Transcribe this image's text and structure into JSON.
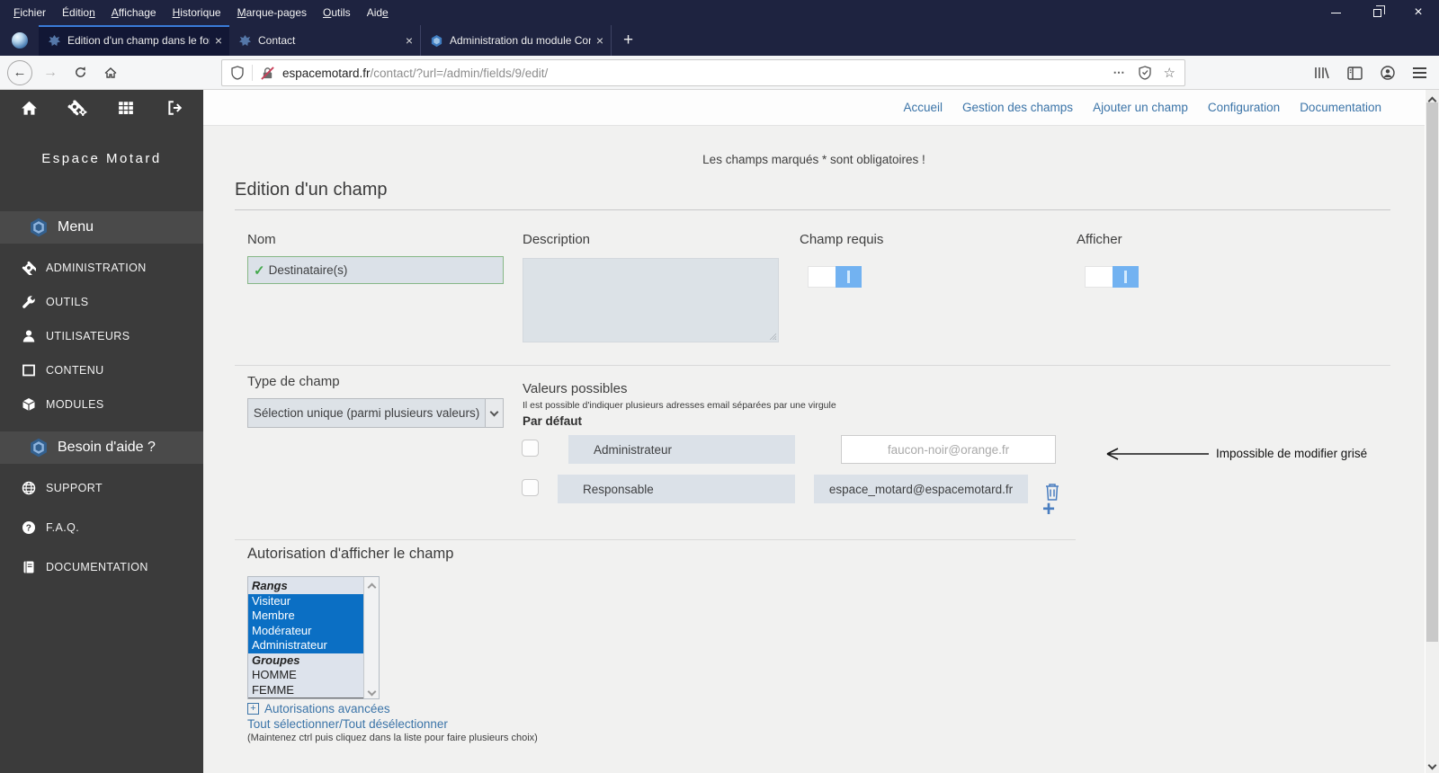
{
  "colors": {
    "titlebar_bg": "#1e2340",
    "active_tab_line": "#3a7bd8",
    "sidebar_bg": "#3b3b3b",
    "sidebar_band_bg": "#4a4a4a",
    "link_blue": "#3b74a8",
    "selection_blue": "#0b6fc4",
    "toggle_blue": "#72b2f1",
    "check_green": "#44a94d",
    "action_blue": "#4a7ec0"
  },
  "icons": {
    "close": "×",
    "new_tab": "+",
    "more": "⋯",
    "star": "☆",
    "back": "←",
    "forward": "→",
    "check": "✓",
    "plus": "+",
    "slash": "/"
  },
  "browser": {
    "menubar": [
      {
        "pre": "",
        "key": "F",
        "post": "ichier"
      },
      {
        "pre": "Éditio",
        "key": "n",
        "post": ""
      },
      {
        "pre": "",
        "key": "A",
        "post": "ffichage"
      },
      {
        "pre": "",
        "key": "H",
        "post": "istorique"
      },
      {
        "pre": "",
        "key": "M",
        "post": "arque-pages"
      },
      {
        "pre": "",
        "key": "O",
        "post": "utils"
      },
      {
        "pre": "Aid",
        "key": "e",
        "post": ""
      }
    ],
    "tabs": [
      {
        "title": "Edition d'un champ dans le for"
      },
      {
        "title": "Contact"
      },
      {
        "title": "Administration du module Con"
      }
    ],
    "url": {
      "domain": "espacemotard.fr",
      "path": "/contact/?url=/admin/fields/9/edit/"
    }
  },
  "sidebar": {
    "brand": "Espace Motard",
    "menu_header": "Menu",
    "items": [
      {
        "label": "ADMINISTRATION"
      },
      {
        "label": "OUTILS"
      },
      {
        "label": "UTILISATEURS"
      },
      {
        "label": "CONTENU"
      },
      {
        "label": "MODULES"
      }
    ],
    "help_header": "Besoin d'aide ?",
    "help_items": [
      {
        "label": "SUPPORT"
      },
      {
        "label": "F.A.Q."
      },
      {
        "label": "DOCUMENTATION"
      }
    ]
  },
  "topnav": {
    "links": [
      "Accueil",
      "Gestion des champs",
      "Ajouter un champ",
      "Configuration",
      "Documentation"
    ]
  },
  "page": {
    "required_note": "Les champs marqués * sont obligatoires !",
    "title": "Edition d'un champ",
    "nom": {
      "label": "Nom",
      "value": "Destinataire(s)"
    },
    "description": {
      "label": "Description"
    },
    "champ_requis": {
      "label": "Champ requis",
      "state": "on"
    },
    "afficher": {
      "label": "Afficher",
      "state": "on"
    },
    "type": {
      "label": "Type de champ",
      "value": "Sélection unique (parmi plusieurs valeurs)"
    },
    "valeurs": {
      "label": "Valeurs possibles",
      "hint": "Il est possible d'indiquer plusieurs adresses email séparées par une virgule",
      "default_label": "Par défaut",
      "rows": [
        {
          "name": "Administrateur",
          "email": "faucon-noir@orange.fr",
          "email_disabled": true
        },
        {
          "name": "Responsable",
          "email": "espace_motard@espacemotard.fr",
          "email_disabled": false
        }
      ]
    },
    "autorisation": {
      "label": "Autorisation d'afficher le champ",
      "items": [
        {
          "label": "Rangs",
          "type": "header",
          "selected": false
        },
        {
          "label": "Visiteur",
          "type": "option",
          "selected": true
        },
        {
          "label": "Membre",
          "type": "option",
          "selected": true
        },
        {
          "label": "Modérateur",
          "type": "option",
          "selected": true
        },
        {
          "label": "Administrateur",
          "type": "option",
          "selected": true
        },
        {
          "label": "Groupes",
          "type": "header",
          "selected": false
        },
        {
          "label": "HOMME",
          "type": "option",
          "selected": false
        },
        {
          "label": "FEMME",
          "type": "option",
          "selected": false
        }
      ],
      "advanced_link": "Autorisations avancées",
      "select_all": "Tout sélectionner",
      "deselect_all": "Tout désélectionner",
      "hint": "(Maintenez ctrl puis cliquez dans la liste pour faire plusieurs choix)"
    }
  },
  "annotation": {
    "text": "Impossible de modifier grisé"
  }
}
